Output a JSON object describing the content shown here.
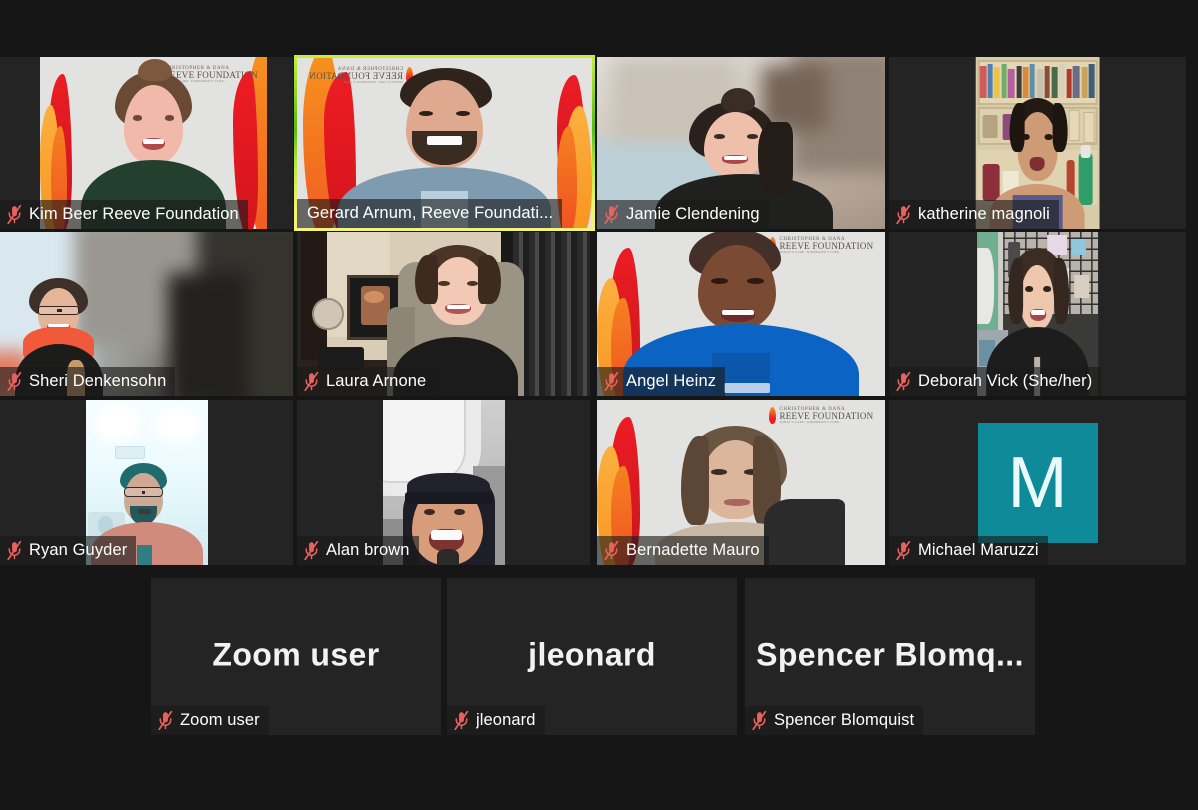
{
  "app": {
    "name": "Zoom",
    "view": "gallery-view",
    "background_color": "#161616",
    "tile_color": "#242424",
    "active_speaker_border_color": "#bdea3a",
    "mute_icon_color": "#e8605f",
    "label_text_color": "#ffffff"
  },
  "participants": [
    {
      "id": "kim-beer",
      "name": "Kim Beer Reeve Foundation",
      "label": "Kim Beer Reeve Foundation",
      "muted": true,
      "mic_icon": "mic-muted-icon",
      "active_speaker": false,
      "video_on": true,
      "background": "reeve-foundation-virtual-background",
      "row": 1,
      "col": 1
    },
    {
      "id": "gerard-arnum",
      "name": "Gerard Arnum, Reeve Foundation",
      "label": "Gerard Arnum, Reeve Foundati...",
      "muted": false,
      "mic_icon": "none",
      "active_speaker": true,
      "video_on": true,
      "background": "reeve-foundation-virtual-background-mirrored",
      "row": 1,
      "col": 2
    },
    {
      "id": "jamie-clendening",
      "name": "Jamie Clendening",
      "label": "Jamie Clendening",
      "muted": true,
      "mic_icon": "mic-muted-icon",
      "active_speaker": false,
      "video_on": true,
      "background": "blurred-room",
      "row": 1,
      "col": 3
    },
    {
      "id": "katherine-magnoli",
      "name": "katherine magnoli",
      "label": "katherine magnoli",
      "muted": true,
      "mic_icon": "mic-muted-icon",
      "active_speaker": false,
      "video_on": true,
      "background": "bookshelf-room",
      "row": 1,
      "col": 4
    },
    {
      "id": "sheri-denkensohn",
      "name": "Sheri Denkensohn",
      "label": "Sheri Denkensohn",
      "muted": true,
      "mic_icon": "mic-muted-icon",
      "active_speaker": false,
      "video_on": true,
      "background": "blurred-bright-room",
      "row": 2,
      "col": 1
    },
    {
      "id": "laura-arnone",
      "name": "Laura Arnone",
      "label": "Laura Arnone",
      "muted": true,
      "mic_icon": "mic-muted-icon",
      "active_speaker": false,
      "video_on": true,
      "background": "home-office-curtains",
      "row": 2,
      "col": 2
    },
    {
      "id": "angel-heinz",
      "name": "Angel Heinz",
      "label": "Angel Heinz",
      "muted": true,
      "mic_icon": "mic-muted-icon",
      "active_speaker": false,
      "video_on": true,
      "background": "reeve-foundation-virtual-background",
      "row": 2,
      "col": 3
    },
    {
      "id": "deborah-vick",
      "name": "Deborah Vick (She/her)",
      "label": "Deborah Vick (She/her)",
      "muted": true,
      "mic_icon": "mic-muted-icon",
      "active_speaker": false,
      "video_on": true,
      "background": "craft-room-pegboard",
      "row": 2,
      "col": 4
    },
    {
      "id": "ryan-guyder",
      "name": "Ryan Guyder",
      "label": "Ryan Guyder",
      "muted": true,
      "mic_icon": "mic-muted-icon",
      "active_speaker": false,
      "video_on": true,
      "background": "bright-ceiling-portrait",
      "row": 3,
      "col": 1
    },
    {
      "id": "alan-brown",
      "name": "Alan brown",
      "label": "Alan brown",
      "muted": true,
      "mic_icon": "mic-muted-icon",
      "active_speaker": false,
      "video_on": true,
      "background": "car-interior-portrait",
      "row": 3,
      "col": 2
    },
    {
      "id": "bernadette-mauro",
      "name": "Bernadette Mauro",
      "label": "Bernadette Mauro",
      "muted": true,
      "mic_icon": "mic-muted-icon",
      "active_speaker": false,
      "video_on": true,
      "background": "reeve-foundation-virtual-background",
      "row": 3,
      "col": 3
    },
    {
      "id": "michael-maruzzi",
      "name": "Michael Maruzzi",
      "label": "Michael Maruzzi",
      "muted": true,
      "mic_icon": "mic-muted-icon",
      "active_speaker": false,
      "video_on": false,
      "avatar_initial": "M",
      "avatar_color": "#0e8a99",
      "row": 3,
      "col": 4
    },
    {
      "id": "zoom-user",
      "name": "Zoom user",
      "label": "Zoom user",
      "big_name": "Zoom user",
      "muted": true,
      "mic_icon": "mic-muted-icon",
      "active_speaker": false,
      "video_on": false,
      "row": 4,
      "col": 1
    },
    {
      "id": "jleonard",
      "name": "jleonard",
      "label": "jleonard",
      "big_name": "jleonard",
      "muted": true,
      "mic_icon": "mic-muted-icon",
      "active_speaker": false,
      "video_on": false,
      "row": 4,
      "col": 2
    },
    {
      "id": "spencer-blomquist",
      "name": "Spencer Blomquist",
      "label": "Spencer Blomquist",
      "big_name": "Spencer  Blomq...",
      "muted": true,
      "mic_icon": "mic-muted-icon",
      "active_speaker": false,
      "video_on": false,
      "row": 4,
      "col": 3
    }
  ],
  "reeve_logo": {
    "line1": "CHRISTOPHER & DANA",
    "line2": "REEVE FOUNDATION",
    "line3": "TODAY'S CARE. TOMORROW'S CURE."
  }
}
